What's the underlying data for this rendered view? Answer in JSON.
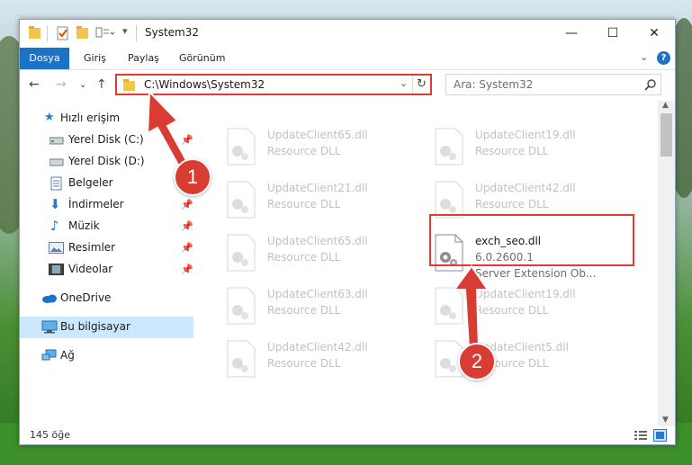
{
  "window": {
    "title": "System32"
  },
  "ribbon": {
    "tabs": [
      "Dosya",
      "Giriş",
      "Paylaş",
      "Görünüm"
    ]
  },
  "nav": {
    "address": "C:\\Windows\\System32",
    "search_placeholder": "Ara: System32"
  },
  "sidebar": {
    "items": [
      {
        "label": "Hızlı erişim",
        "icon": "star-icon"
      },
      {
        "label": "Yerel Disk (C:)",
        "icon": "drive-icon",
        "pinned": true
      },
      {
        "label": "Yerel Disk (D:)",
        "icon": "drive-icon"
      },
      {
        "label": "Belgeler",
        "icon": "documents-icon"
      },
      {
        "label": "İndirmeler",
        "icon": "download-icon",
        "pinned": true
      },
      {
        "label": "Müzik",
        "icon": "music-icon",
        "pinned": true
      },
      {
        "label": "Resimler",
        "icon": "pictures-icon",
        "pinned": true
      },
      {
        "label": "Videolar",
        "icon": "videos-icon",
        "pinned": true
      },
      {
        "label": "OneDrive",
        "icon": "cloud-icon"
      },
      {
        "label": "Bu bilgisayar",
        "icon": "computer-icon",
        "selected": true
      },
      {
        "label": "Ağ",
        "icon": "network-icon"
      }
    ]
  },
  "files": [
    {
      "name": "UpdateClient65.dll",
      "desc": "Resource DLL"
    },
    {
      "name": "UpdateClient19.dll",
      "desc": "Resource DLL"
    },
    {
      "name": "UpdateClient21.dll",
      "desc": "Resource DLL"
    },
    {
      "name": "UpdateClient42.dll",
      "desc": "Resource DLL"
    },
    {
      "name": "UpdateClient65.dll",
      "desc": "Resource DLL"
    },
    {
      "name": "exch_seo.dll",
      "version": "6.0.2600.1",
      "desc": "Server Extension Ob..."
    },
    {
      "name": "UpdateClient63.dll",
      "desc": "Resource DLL"
    },
    {
      "name": "UpdateClient19.dll",
      "desc": "Resource DLL"
    },
    {
      "name": "UpdateClient42.dll",
      "desc": "Resource DLL"
    },
    {
      "name": "UpdateClient5.dll",
      "desc": "Resource DLL"
    }
  ],
  "status": {
    "count": "145 öğe"
  },
  "annotations": {
    "step1": "1",
    "step2": "2"
  },
  "colors": {
    "accent": "#1a73c8",
    "highlight": "#e53935",
    "badge": "#d93c32"
  }
}
